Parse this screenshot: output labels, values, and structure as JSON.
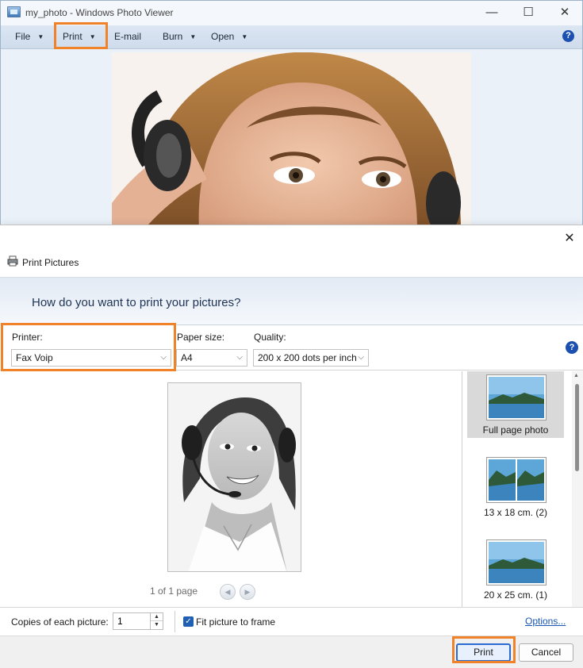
{
  "window": {
    "title": "my_photo - Windows Photo Viewer",
    "controls": {
      "minimize": "—",
      "maximize": "☐",
      "close": "✕"
    }
  },
  "menubar": {
    "items": [
      {
        "label": "File",
        "has_dropdown": true
      },
      {
        "label": "Print",
        "has_dropdown": true
      },
      {
        "label": "E-mail",
        "has_dropdown": false
      },
      {
        "label": "Burn",
        "has_dropdown": true
      },
      {
        "label": "Open",
        "has_dropdown": true
      }
    ],
    "caret": "▼",
    "help": "?"
  },
  "dialog": {
    "title": "Print Pictures",
    "close": "✕",
    "question": "How do you want to print your pictures?",
    "printer": {
      "label": "Printer:",
      "value": "Fax Voip"
    },
    "paper_size": {
      "label": "Paper size:",
      "value": "A4"
    },
    "quality": {
      "label": "Quality:",
      "value": "200 x 200 dots per inch"
    },
    "chevron": "⌵",
    "help": "?",
    "preview": {
      "page_count": "1 of 1 page",
      "prev": "◀",
      "next": "▶"
    },
    "layouts": [
      {
        "label": "Full page photo",
        "selected": true
      },
      {
        "label": "13 x 18 cm. (2)",
        "selected": false
      },
      {
        "label": "20 x 25 cm. (1)",
        "selected": false
      }
    ],
    "copies": {
      "label": "Copies of each picture:",
      "value": "1",
      "up": "▲",
      "down": "▼"
    },
    "fit_to_frame": {
      "label": "Fit picture to frame",
      "checked": true,
      "mark": "✓"
    },
    "options_link": "Options...",
    "buttons": {
      "print": "Print",
      "cancel": "Cancel"
    }
  },
  "colors": {
    "highlight": "#f0832a",
    "accent": "#1b4fb0",
    "link": "#1a56b3"
  }
}
